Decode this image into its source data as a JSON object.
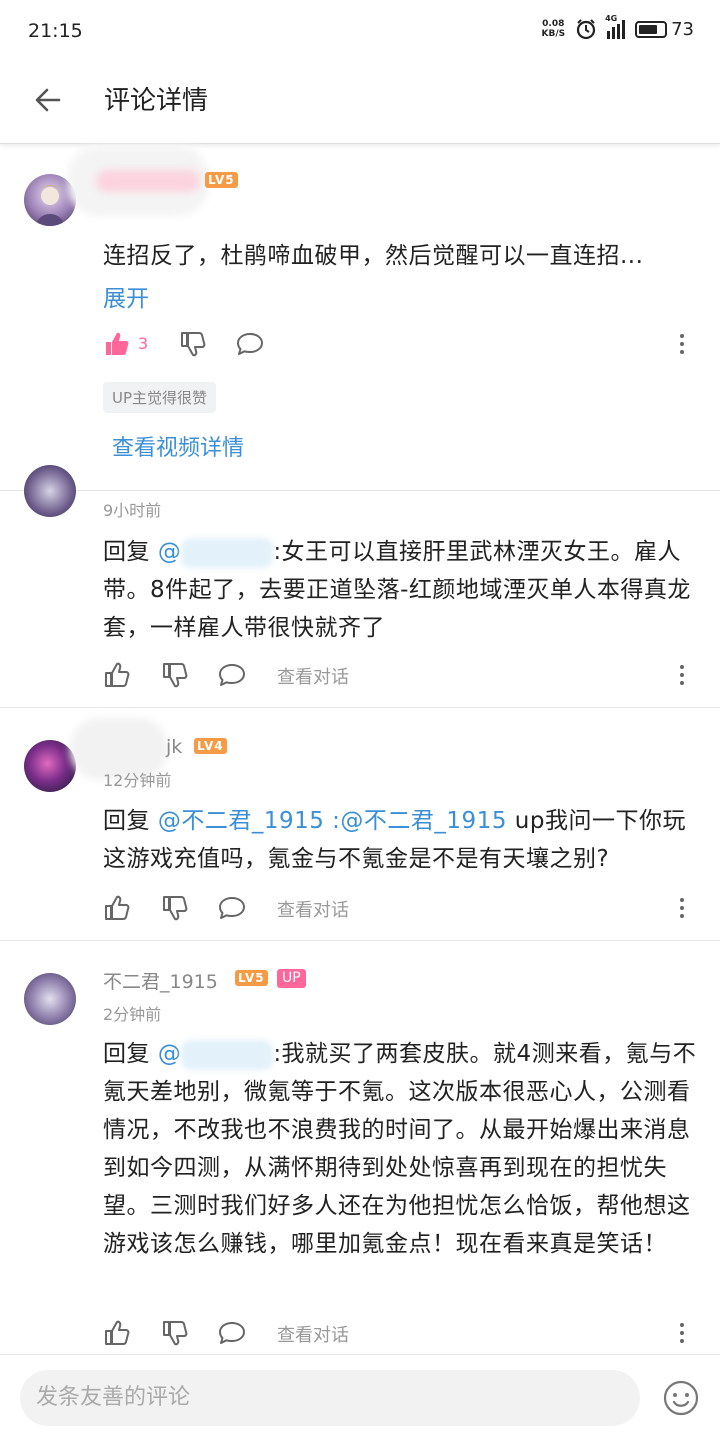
{
  "status": {
    "time": "21:15",
    "net_speed_value": "0.08",
    "net_speed_unit": "KB/S",
    "signal": "4G",
    "battery": "73"
  },
  "header": {
    "title": "评论详情",
    "back_icon": "arrow-left-icon"
  },
  "main_comment": {
    "level": "LV5",
    "text": "连招反了，杜鹃啼血破甲，然后觉醒可以一直连招...",
    "expand_label": "展开",
    "like_count": "3",
    "up_badge": "UP主觉得很赞",
    "video_link": "查看视频详情",
    "accent_color": "#ff6699"
  },
  "replies": [
    {
      "time": "9小时前",
      "prefix": "回复 ",
      "mention": "@",
      "text": ":女王可以直接肝里武林湮灭女王。雇人带。8件起了，去要正道坠落-红颜地域湮灭单人本得真龙套，一样雇人带很快就齐了",
      "view_dialog": "查看对话"
    },
    {
      "name_suffix": "jk",
      "level": "LV4",
      "time": "12分钟前",
      "prefix": "回复 ",
      "mention": "@不二君_1915",
      "mention2": ":@不二君_1915",
      "text": " up我问一下你玩这游戏充值吗，氪金与不氪金是不是有天壤之别?",
      "view_dialog": "查看对话"
    },
    {
      "name": "不二君_1915",
      "level": "LV5",
      "up_tag": "UP",
      "time": "2分钟前",
      "prefix": "回复 ",
      "mention": "@",
      "text": ":我就买了两套皮肤。就4测来看，氪与不氪天差地别，微氪等于不氪。这次版本很恶心人，公测看情况，不改我也不浪费我的时间了。从最开始爆出来消息到如今四测，从满怀期待到处处惊喜再到现在的担忧失望。三测时我们好多人还在为他担忧怎么恰饭，帮他想这游戏该怎么赚钱，哪里加氪金点！现在看来真是笑话！",
      "view_dialog": "查看对话"
    }
  ],
  "composer": {
    "placeholder": "发条友善的评论",
    "emoji_icon": "smiley-icon"
  },
  "colors": {
    "link": "#3a8fd6",
    "level_badge": "#f59b45",
    "up_tag": "#ff6699"
  }
}
